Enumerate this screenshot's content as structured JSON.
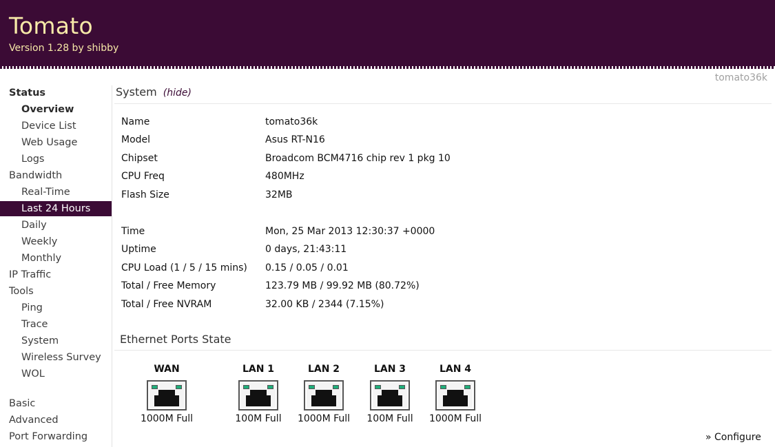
{
  "header": {
    "brand": "Tomato",
    "version": "Version 1.28 by shibby"
  },
  "hostname": "tomato36k",
  "sidebar": {
    "items": [
      {
        "label": "Status"
      },
      {
        "label": "Overview"
      },
      {
        "label": "Device List"
      },
      {
        "label": "Web Usage"
      },
      {
        "label": "Logs"
      },
      {
        "label": "Bandwidth"
      },
      {
        "label": "Real-Time"
      },
      {
        "label": "Last 24 Hours"
      },
      {
        "label": "Daily"
      },
      {
        "label": "Weekly"
      },
      {
        "label": "Monthly"
      },
      {
        "label": "IP Traffic"
      },
      {
        "label": "Tools"
      },
      {
        "label": "Ping"
      },
      {
        "label": "Trace"
      },
      {
        "label": "System"
      },
      {
        "label": "Wireless Survey"
      },
      {
        "label": "WOL"
      },
      {
        "label": "Basic"
      },
      {
        "label": "Advanced"
      },
      {
        "label": "Port Forwarding"
      }
    ]
  },
  "system": {
    "title": "System",
    "hide_label": "(hide)",
    "rows": [
      {
        "label": "Name",
        "value": "tomato36k"
      },
      {
        "label": "Model",
        "value": "Asus RT-N16"
      },
      {
        "label": "Chipset",
        "value": "Broadcom BCM4716 chip rev 1 pkg 10"
      },
      {
        "label": "CPU Freq",
        "value": "480MHz"
      },
      {
        "label": "Flash Size",
        "value": "32MB"
      },
      {
        "label": "Time",
        "value": "Mon, 25 Mar 2013 12:30:37 +0000"
      },
      {
        "label": "Uptime",
        "value": "0 days, 21:43:11"
      },
      {
        "label": "CPU Load (1 / 5 / 15 mins)",
        "value": "0.15 / 0.05 / 0.01"
      },
      {
        "label": "Total / Free Memory",
        "value": "123.79 MB / 99.92 MB (80.72%)"
      },
      {
        "label": "Total / Free NVRAM",
        "value": "32.00 KB / 2344 (7.15%)"
      }
    ]
  },
  "ports": {
    "title": "Ethernet Ports State",
    "items": [
      {
        "label": "WAN",
        "speed": "1000M Full"
      },
      {
        "label": "LAN 1",
        "speed": "100M Full"
      },
      {
        "label": "LAN 2",
        "speed": "1000M Full"
      },
      {
        "label": "LAN 3",
        "speed": "100M Full"
      },
      {
        "label": "LAN 4",
        "speed": "1000M Full"
      }
    ],
    "configure_label": "» Configure"
  },
  "colors": {
    "brand_bg": "#3b0b35",
    "brand_text": "#f7e9a8",
    "led": "#1fae7a"
  }
}
